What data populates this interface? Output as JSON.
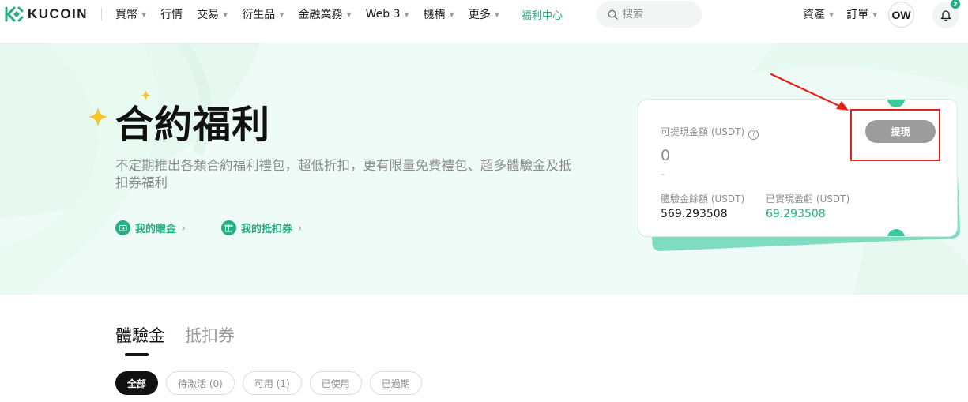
{
  "brand": {
    "name": "KUCOIN",
    "accent_color": "#23af86"
  },
  "nav": {
    "menu": [
      {
        "label": "買幣",
        "has_dropdown": true
      },
      {
        "label": "行情",
        "has_dropdown": false
      },
      {
        "label": "交易",
        "has_dropdown": true
      },
      {
        "label": "衍生品",
        "has_dropdown": true
      },
      {
        "label": "金融業務",
        "has_dropdown": true
      },
      {
        "label": "Web 3",
        "has_dropdown": true
      },
      {
        "label": "機構",
        "has_dropdown": true
      },
      {
        "label": "更多",
        "has_dropdown": true
      }
    ],
    "active_link": "福利中心",
    "search_placeholder": "搜索",
    "right": [
      {
        "label": "資產",
        "has_dropdown": true
      },
      {
        "label": "訂單",
        "has_dropdown": true
      }
    ],
    "avatar": "OW",
    "notification_count": "2",
    "icons": [
      "kucoin-logo-icon",
      "search-icon",
      "bell-icon",
      "chevron-down-icon"
    ]
  },
  "hero": {
    "title": "合約福利",
    "description": "不定期推出各類合約福利禮包，超低折扣，更有限量免費禮包、超多體驗金及抵扣券福利",
    "links": [
      {
        "label": "我的贈金",
        "icon": "gift-money-icon"
      },
      {
        "label": "我的抵扣券",
        "icon": "coupon-icon"
      }
    ]
  },
  "card": {
    "withdrawable_label": "可提現金額 (USDT)",
    "help_glyph": "?",
    "withdrawable_amount": "0",
    "withdrawable_sub": "–",
    "withdraw_button": "提現",
    "trial_balance_label": "體驗金餘額 (USDT)",
    "trial_balance_value": "569.293508",
    "realized_pnl_label": "已實現盈虧 (USDT)",
    "realized_pnl_value": "69.293508",
    "annotation_color": "#e3231b"
  },
  "tabs": [
    {
      "label": "體驗金",
      "active": true
    },
    {
      "label": "抵扣券",
      "active": false
    }
  ],
  "filters": [
    {
      "label": "全部",
      "active": true
    },
    {
      "label": "待激活 (0)",
      "active": false
    },
    {
      "label": "可用 (1)",
      "active": false
    },
    {
      "label": "已使用",
      "active": false
    },
    {
      "label": "已過期",
      "active": false
    }
  ]
}
